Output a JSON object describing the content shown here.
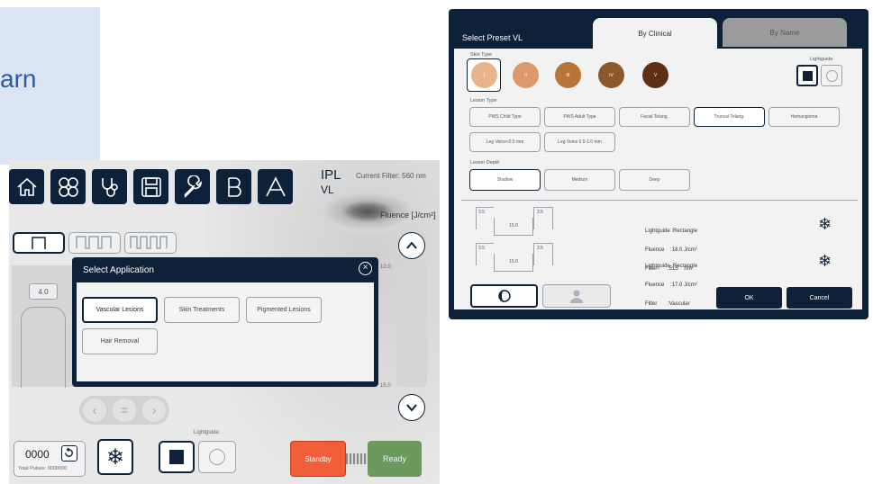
{
  "slide": {
    "partial_text": "arn"
  },
  "left_screen": {
    "brand": {
      "name": "IPL",
      "sub": "VL"
    },
    "current_filter": "Current Filter: 560 nm",
    "fluence_label": "Fluence [J/cm²]",
    "left_value": "4.0",
    "slider_tick_top": "12.0",
    "slider_tick_bottom": "15.0",
    "toolbar_icons": [
      "home-icon",
      "applications-icon",
      "stethoscope-icon",
      "save-icon",
      "wrench-icon",
      "b-letter-icon",
      "a-letter-icon"
    ],
    "dialog": {
      "title": "Select Application",
      "options": [
        "Vascular Lesions",
        "Skin Treatments",
        "Pigmented Lesions",
        "Hair Removal"
      ]
    },
    "counter": {
      "value": "0000",
      "total_label": "Total Pulses: 0000000"
    },
    "lightguide_label": "Lightguide:",
    "standby_label": "Standby",
    "ready_label": "Ready"
  },
  "right_screen": {
    "title": "Select Preset VL",
    "tabs": [
      "By Clinical",
      "By Name"
    ],
    "skin_type_label": "Skin Type",
    "skin_types": [
      {
        "label": "I",
        "color": "#e9b48c"
      },
      {
        "label": "II",
        "color": "#dc9a6a"
      },
      {
        "label": "III",
        "color": "#b87537"
      },
      {
        "label": "IV",
        "color": "#8c5a2a"
      },
      {
        "label": "V",
        "color": "#5e2f12"
      }
    ],
    "lightguide_label": "Lightguide",
    "lesion_type_label": "Lesion Type",
    "lesion_types": [
      "PWS Child Type",
      "PWS Adult Type",
      "Facial Telang.",
      "Truncal Telang.",
      "Hemangioma",
      "Leg Veins<0.5 mm",
      "Leg Veins 0.5-1.0 mm"
    ],
    "lesion_depth_label": "Lesion Depth",
    "lesion_depths": [
      "Shallow",
      "Medium",
      "Deep"
    ],
    "presets": [
      {
        "a": "3.5",
        "b": "15.0",
        "c": "3.5",
        "lightguide": ":Rectangle",
        "fluence": ":18.0",
        "unit": "J/cm²",
        "filter": ":515    nm"
      },
      {
        "a": "3.5",
        "b": "15.0",
        "c": "3.5",
        "lightguide": ":Rectangle",
        "fluence": ":17.0",
        "unit": "J/cm²",
        "filter": ":Vascular"
      }
    ],
    "info_labels": {
      "lightguide": "Lightguide",
      "fluence": "Fluence",
      "filter": "Filter"
    },
    "ok_label": "OK",
    "cancel_label": "Cancel"
  }
}
